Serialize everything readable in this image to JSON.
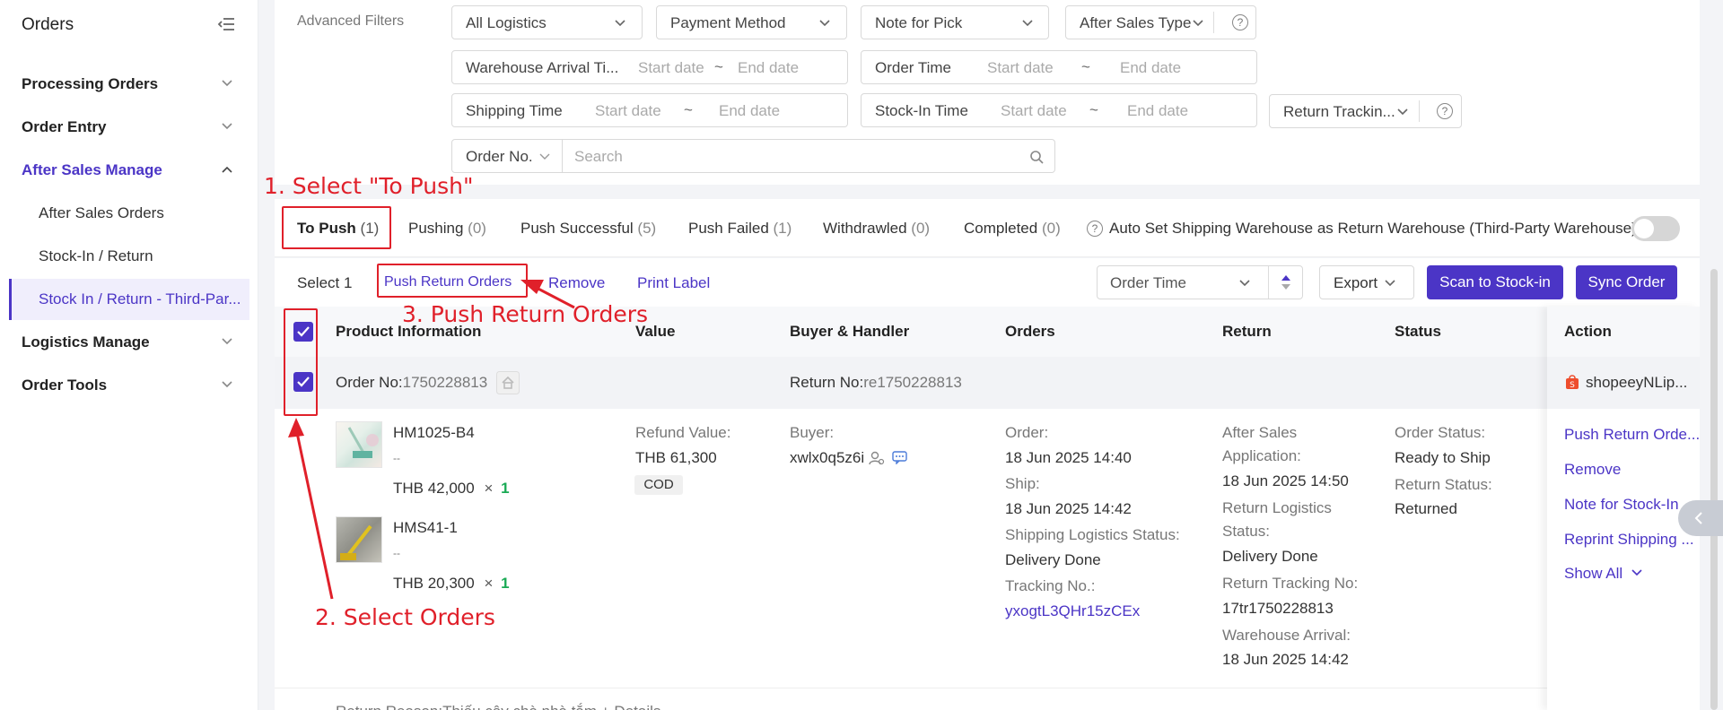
{
  "sidebar": {
    "title": "Orders",
    "items": [
      {
        "label": "Processing Orders"
      },
      {
        "label": "Order Entry"
      },
      {
        "label": "After Sales Manage"
      },
      {
        "label": "Logistics Manage"
      },
      {
        "label": "Order Tools"
      }
    ],
    "sub_items": [
      {
        "label": "After Sales Orders"
      },
      {
        "label": "Stock-In / Return"
      },
      {
        "label": "Stock In / Return - Third-Par..."
      }
    ]
  },
  "filters": {
    "label": "Advanced Filters",
    "all_logistics": "All Logistics",
    "payment_method": "Payment Method",
    "note_for_pick": "Note for Pick",
    "after_sales_type": "After Sales Type",
    "warehouse_arrival": "Warehouse Arrival Ti...",
    "order_time": "Order Time",
    "shipping_time": "Shipping Time",
    "stock_in_time": "Stock-In Time",
    "return_tracking": "Return Trackin...",
    "start_date": "Start date",
    "end_date": "End date",
    "tilde": "~",
    "order_no": "Order No.",
    "search_placeholder": "Search"
  },
  "tabs": [
    {
      "label": "To Push",
      "count": "(1)"
    },
    {
      "label": "Pushing",
      "count": "(0)"
    },
    {
      "label": "Push Successful",
      "count": "(5)"
    },
    {
      "label": "Push Failed",
      "count": "(1)"
    },
    {
      "label": "Withdrawled",
      "count": "(0)"
    },
    {
      "label": "Completed",
      "count": "(0)"
    }
  ],
  "auto_set_label": "Auto Set Shipping Warehouse as Return Warehouse (Third-Party Warehouse)",
  "toolbar": {
    "select_count": "Select 1",
    "push_return_orders": "Push Return Orders",
    "remove": "Remove",
    "print_label": "Print Label",
    "sort_field": "Order Time",
    "export": "Export",
    "scan_to_stock_in": "Scan to Stock-in",
    "sync_order": "Sync Order"
  },
  "table": {
    "headers": {
      "product": "Product Information",
      "value": "Value",
      "buyer": "Buyer & Handler",
      "orders": "Orders",
      "return": "Return",
      "status": "Status",
      "action": "Action"
    },
    "order": {
      "order_no_label": "Order No:",
      "order_no": "1750228813",
      "return_no_label": "Return No:",
      "return_no": "re1750228813",
      "shop": "shopeeyNLip...",
      "products": [
        {
          "sku": "HM1025-B4",
          "dash": "--",
          "price": "THB 42,000",
          "times": "×",
          "qty": "1"
        },
        {
          "sku": "HMS41-1",
          "dash": "--",
          "price": "THB 20,300",
          "times": "×",
          "qty": "1"
        }
      ],
      "refund_label": "Refund Value:",
      "refund_value": "THB 61,300",
      "payment": "COD",
      "buyer_label": "Buyer:",
      "buyer": "xwlx0q5z6i",
      "order_label": "Order:",
      "order_time": "18 Jun 2025 14:40",
      "ship_label": "Ship:",
      "ship_time": "18 Jun 2025 14:42",
      "shipping_status_label": "Shipping Logistics Status:",
      "shipping_status": "Delivery Done",
      "tracking_label": "Tracking No.:",
      "tracking_no": "yxogtL3QHr15zCEx",
      "after_sales_label_1": "After Sales",
      "after_sales_label_2": "Application:",
      "after_sales_time": "18 Jun 2025 14:50",
      "return_logistics_label_1": "Return Logistics",
      "return_logistics_label_2": "Status:",
      "return_logistics_status": "Delivery Done",
      "return_tracking_label": "Return Tracking No:",
      "return_tracking_no": "17tr1750228813",
      "warehouse_arrival_label": "Warehouse Arrival:",
      "warehouse_arrival": "18 Jun 2025 14:42",
      "order_status_label": "Order Status:",
      "order_status": "Ready to Ship",
      "return_status_label": "Return Status:",
      "return_status": "Returned",
      "actions": [
        "Push Return Orde...",
        "Remove",
        "Note for Stock-In",
        "Reprint Shipping ...",
        "Show All"
      ],
      "return_reason": "Return Reason:Thiếu cây chà nhà tắm + Details"
    }
  },
  "annotations": {
    "step1": "1. Select \"To Push\"",
    "step2": "2. Select Orders",
    "step3": "3. Push Return Orders"
  },
  "colors": {
    "accent": "#4b35c6",
    "annotation": "#e0202a",
    "qty": "#1aaa55"
  }
}
